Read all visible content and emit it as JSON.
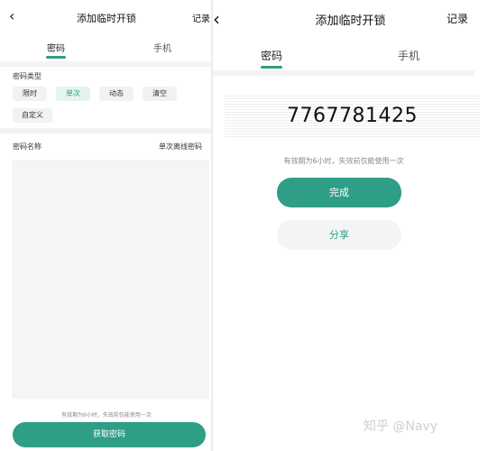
{
  "left": {
    "header": {
      "back_icon": "chevron-left-icon",
      "title": "添加临时开锁",
      "record_label": "记录"
    },
    "tabs": [
      {
        "label": "密码",
        "active": true
      },
      {
        "label": "手机",
        "active": false
      }
    ],
    "password_type": {
      "label": "密码类型",
      "options": [
        {
          "label": "限时",
          "active": false
        },
        {
          "label": "单次",
          "active": true
        },
        {
          "label": "动态",
          "active": false
        },
        {
          "label": "清空",
          "active": false
        },
        {
          "label": "自定义",
          "active": false
        }
      ]
    },
    "password_name": {
      "label": "密码名称",
      "value": "单次离线密码"
    },
    "hint": "有效期为6小时，失效前仅能使用一次",
    "get_button": "获取密码"
  },
  "right": {
    "header": {
      "back_icon": "chevron-left-icon",
      "title": "添加临时开锁",
      "record_label": "记录"
    },
    "tabs": [
      {
        "label": "密码",
        "active": true
      },
      {
        "label": "手机",
        "active": false
      }
    ],
    "password": "7767781425",
    "hint": "有效期为6小时，失效前仅能使用一次",
    "done_button": "完成",
    "share_button": "分享"
  },
  "watermark": "知乎 @Navy",
  "colors": {
    "accent": "#2f9e86",
    "chip_active_bg": "#e6f4ef",
    "chip_bg": "#f1f3f2"
  }
}
